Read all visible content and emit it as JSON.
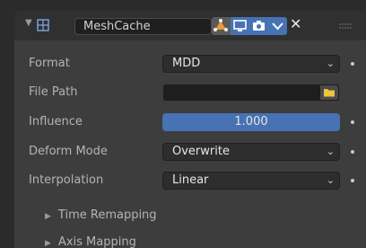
{
  "modifier": {
    "name": "MeshCache",
    "icon": "modifier-mesh-icon",
    "close_symbol": "✕"
  },
  "properties": {
    "format": {
      "label": "Format",
      "value": "MDD"
    },
    "file_path": {
      "label": "File Path",
      "value": ""
    },
    "influence": {
      "label": "Influence",
      "value": "1.000",
      "fraction": 1.0
    },
    "deform_mode": {
      "label": "Deform Mode",
      "value": "Overwrite"
    },
    "interpolation": {
      "label": "Interpolation",
      "value": "Linear"
    }
  },
  "subpanels": [
    {
      "label": "Time Remapping"
    },
    {
      "label": "Axis Mapping"
    }
  ],
  "colors": {
    "accent": "#4772b3",
    "panel": "#3d3d3d",
    "header": "#303030",
    "folder": "#f0c43a"
  }
}
